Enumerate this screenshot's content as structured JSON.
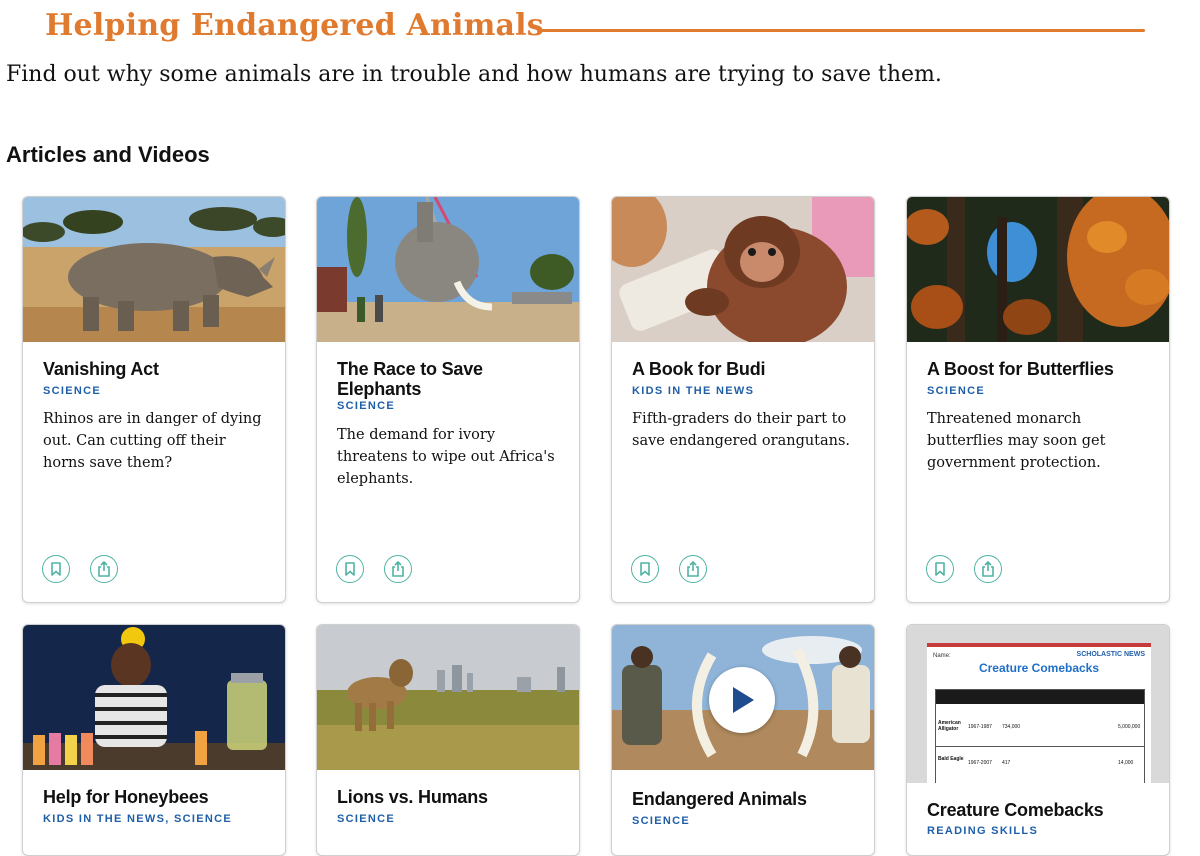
{
  "page": {
    "title": "Helping Endangered Animals",
    "intro": "Find out why some animals are in trouble and how humans are trying to save them.",
    "section_heading": "Articles and Videos"
  },
  "colors": {
    "title_accent": "#e07a2e",
    "tag_blue": "#1f5fa8",
    "icon_teal": "#4fb3a4"
  },
  "cards": [
    {
      "title": "Vanishing Act",
      "tag": "SCIENCE",
      "description": "Rhinos are in danger of dying out. Can cutting off their horns save them?",
      "image": "rhino-photo"
    },
    {
      "title": "The Race to Save Elephants",
      "tag": "SCIENCE",
      "description": "The demand for ivory threatens to wipe out Africa's elephants.",
      "image": "elephant-lift-photo"
    },
    {
      "title": "A Book for Budi",
      "tag": "KIDS IN THE NEWS",
      "description": "Fifth-graders do their part to save endangered orangutans.",
      "image": "baby-orangutan-photo"
    },
    {
      "title": "A Boost for Butterflies",
      "tag": "SCIENCE",
      "description": "Threatened monarch butterflies may soon get government protection.",
      "image": "monarch-butterflies-photo"
    },
    {
      "title": "Help for Honeybees",
      "tag": "KIDS IN THE NEWS, SCIENCE",
      "image": "girl-lemonade-photo"
    },
    {
      "title": "Lions vs. Humans",
      "tag": "SCIENCE",
      "image": "lion-city-photo"
    },
    {
      "title": "Endangered Animals",
      "tag": "SCIENCE",
      "image": "ivory-tusks-photo",
      "video": true
    },
    {
      "title": "Creature Comebacks",
      "tag": "READING SKILLS",
      "image": "worksheet-preview",
      "worksheet": {
        "brand": "SCHOLASTIC NEWS",
        "heading": "Creature Comebacks",
        "name_label": "Name:",
        "columns": [
          "ANIMAL",
          "YEARS ON ENDANGERED SPECIES LIST",
          "LOWEST POPULATION",
          "MAIN THREAT AND RESPONSE",
          "CURRENT POPULATION"
        ],
        "rows": [
          [
            "American Alligator",
            "1967-1987",
            "734,000",
            "5,000,000"
          ],
          [
            "Bald Eagle",
            "1967-2007",
            "417",
            "14,000"
          ]
        ]
      }
    }
  ]
}
